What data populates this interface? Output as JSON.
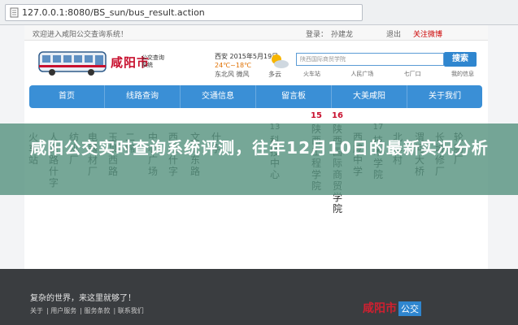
{
  "browser": {
    "url": "127.0.0.1:8080/BS_sun/bus_result.action"
  },
  "topbar": {
    "welcome": "欢迎进入咸阳公交查询系统！",
    "login_label": "登录：",
    "user": "孙建龙",
    "logout": "退出",
    "weibo": "关注微博"
  },
  "logo": {
    "red_text": "咸阳市",
    "small_text": "公交查询系统"
  },
  "weather": {
    "city_date": "西安 2015年5月19日",
    "temp": "24℃~18℃",
    "condition": "多云",
    "wind": "东北风 微风"
  },
  "search": {
    "placeholder": "陕西国际商贸学院",
    "button": "搜索",
    "links": [
      "火车站",
      "人民广场",
      "七厂口",
      "我的信息"
    ]
  },
  "nav": [
    "首页",
    "线路查询",
    "交通信息",
    "留言板",
    "大美咸阳",
    "关于我们"
  ],
  "stops": [
    {
      "num": "",
      "text": "火车站"
    },
    {
      "num": "",
      "text": "人民路什字"
    },
    {
      "num": "",
      "text": "纺机厂"
    },
    {
      "num": "",
      "text": "电器材厂"
    },
    {
      "num": "",
      "text": "玉泉西路"
    },
    {
      "num": "",
      "text": "二棉"
    },
    {
      "num": "",
      "text": "中心广场"
    },
    {
      "num": "",
      "text": "西门什字"
    },
    {
      "num": "",
      "text": "文汇东路"
    },
    {
      "num": "",
      "text": "什字"
    },
    {
      "num": "13",
      "text": "科技中心"
    },
    {
      "num": "15",
      "text": "陕西工程学院",
      "red": true
    },
    {
      "num": "16",
      "text": "陕西国际商贸学院",
      "red": true
    },
    {
      "num": "",
      "text": "西咸中学"
    },
    {
      "num": "17",
      "text": "技术学院"
    },
    {
      "num": "",
      "text": "北季村"
    },
    {
      "num": "",
      "text": "渭河大桥"
    },
    {
      "num": "",
      "text": "长城修厂"
    },
    {
      "num": "",
      "text": "轮胎厂"
    }
  ],
  "banner": {
    "title": "咸阳公交实时查询系统评测，往年12月10日的最新实况分析"
  },
  "footer": {
    "tagline": "复杂的世界，来这里就够了！",
    "links": [
      "关于",
      "用户服务",
      "服务条款",
      "联系我们"
    ],
    "logo_red": "咸阳市",
    "logo_box": "公交"
  }
}
